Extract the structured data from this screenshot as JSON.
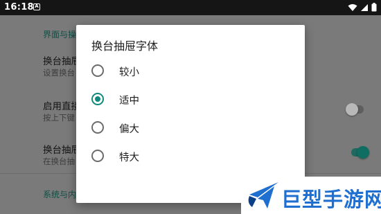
{
  "status_bar": {
    "time": "16:18",
    "notification_letter": "A",
    "icons": [
      "wifi-icon",
      "signal-icon",
      "battery-icon"
    ]
  },
  "settings": {
    "section1_header": "界面与操",
    "pref1_title": "换台抽屉",
    "pref1_summary": "设置换台",
    "pref2_title": "启用直接",
    "pref2_summary": "按上下键",
    "pref2_switch_on": false,
    "pref3_title": "换台抽屉",
    "pref3_summary": "在换台抽",
    "pref3_switch_on": true,
    "section2_header": "系统与内"
  },
  "dialog": {
    "title": "换台抽屉字体",
    "options": [
      {
        "label": "较小",
        "checked": false
      },
      {
        "label": "适中",
        "checked": true
      },
      {
        "label": "偏大",
        "checked": false
      },
      {
        "label": "特大",
        "checked": false
      }
    ]
  },
  "watermark": {
    "text": "巨型手游网"
  },
  "colors": {
    "accent": "#0f8a7c",
    "switch_off_track": "#5e5e5e",
    "switch_off_thumb": "#b8b8b8",
    "switch_on_track": "#1f6a60",
    "switch_on_thumb": "#0f6d61",
    "watermark": "#1f6fd1"
  }
}
